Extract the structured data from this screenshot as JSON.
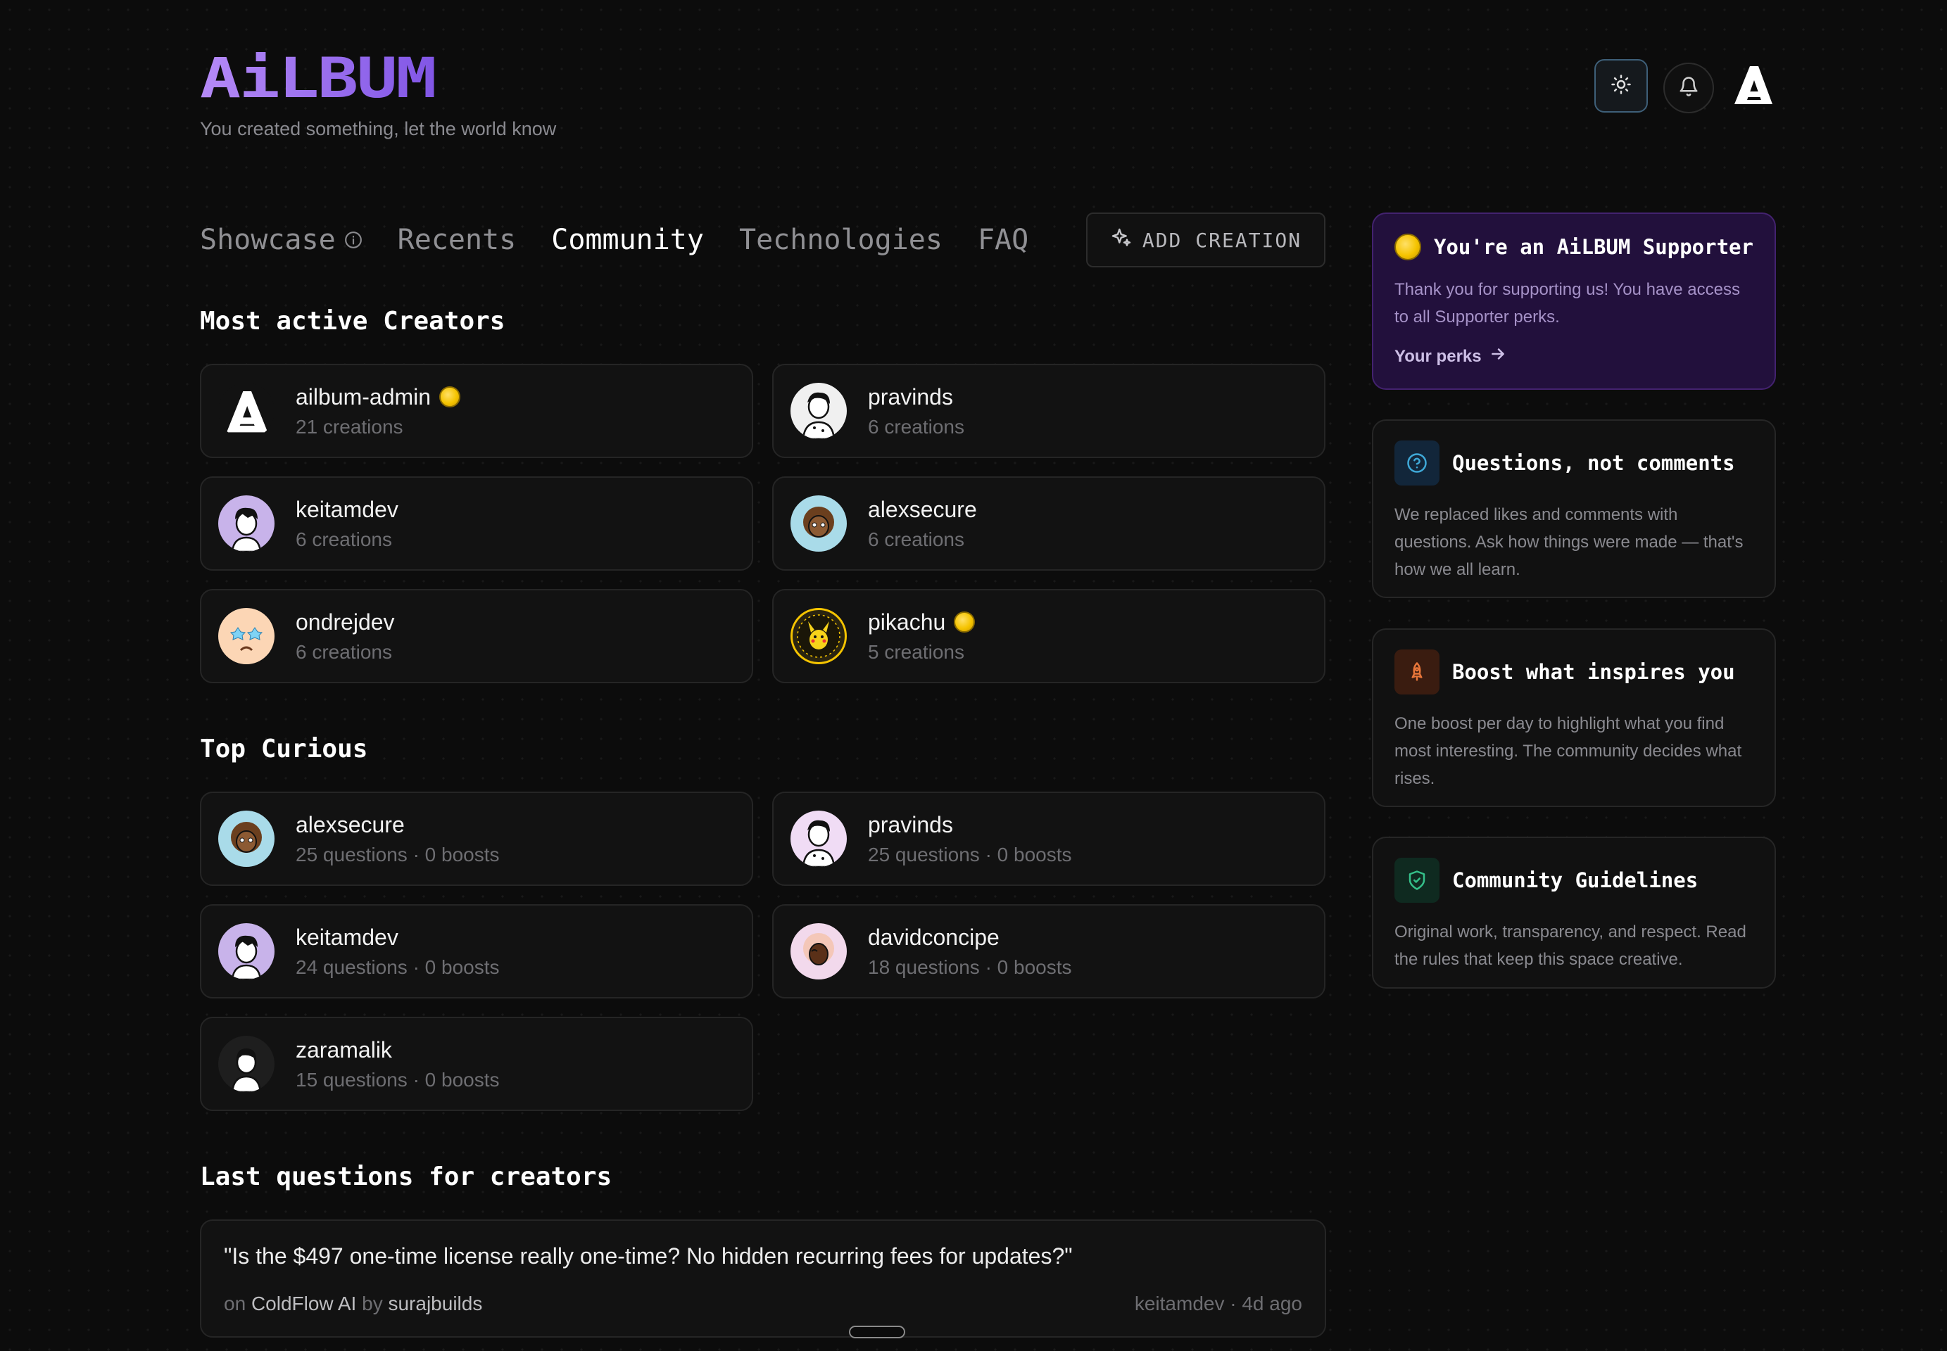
{
  "header": {
    "logo": "AiLBUM",
    "tagline": "You created something, let the world know",
    "theme_icon": "sun-icon",
    "notifications_icon": "bell-icon",
    "profile_icon": "profile-a-icon"
  },
  "nav": {
    "tabs": [
      {
        "label": "Showcase",
        "active": false,
        "has_info": true
      },
      {
        "label": "Recents",
        "active": false
      },
      {
        "label": "Community",
        "active": true
      },
      {
        "label": "Technologies",
        "active": false
      },
      {
        "label": "FAQ",
        "active": false
      }
    ],
    "add_creation_label": "ADD CREATION"
  },
  "most_active": {
    "title": "Most active Creators",
    "creators": [
      {
        "name": "ailbum-admin",
        "sub": "21 creations",
        "supporter": true
      },
      {
        "name": "pravinds",
        "sub": "6 creations",
        "supporter": false
      },
      {
        "name": "keitamdev",
        "sub": "6 creations",
        "supporter": false
      },
      {
        "name": "alexsecure",
        "sub": "6 creations",
        "supporter": false
      },
      {
        "name": "ondrejdev",
        "sub": "6 creations",
        "supporter": false
      },
      {
        "name": "pikachu",
        "sub": "5 creations",
        "supporter": true
      }
    ]
  },
  "top_curious": {
    "title": "Top Curious",
    "users": [
      {
        "name": "alexsecure",
        "sub": "25 questions · 0 boosts"
      },
      {
        "name": "pravinds",
        "sub": "25 questions · 0 boosts"
      },
      {
        "name": "keitamdev",
        "sub": "24 questions · 0 boosts"
      },
      {
        "name": "davidconcipe",
        "sub": "18 questions · 0 boosts"
      },
      {
        "name": "zaramalik",
        "sub": "15 questions · 0 boosts"
      }
    ]
  },
  "last_questions": {
    "title": "Last questions for creators",
    "items": [
      {
        "question": "\"Is the $497 one-time license really one-time? No hidden recurring fees for updates?\"",
        "on_label": "on",
        "project": "ColdFlow AI",
        "by_label": "by",
        "creator": "surajbuilds",
        "asker_meta": "keitamdev · 4d ago"
      }
    ]
  },
  "sidebar": {
    "supporter": {
      "title": "You're an AiLBUM Supporter",
      "body": "Thank you for supporting us! You have access to all Supporter perks.",
      "link": "Your perks"
    },
    "cards": [
      {
        "title": "Questions, not comments",
        "body": "We replaced likes and comments with questions. Ask how things were made — that's how we all learn.",
        "icon": "question-circle-icon",
        "color": "#3fa9d8"
      },
      {
        "title": "Boost what inspires you",
        "body": "One boost per day to highlight what you find most interesting. The community decides what rises.",
        "icon": "rocket-icon",
        "color": "#e8763a"
      },
      {
        "title": "Community Guidelines",
        "body": "Original work, transparency, and respect. Read the rules that keep this space creative.",
        "icon": "shield-check-icon",
        "color": "#35c08a"
      }
    ]
  },
  "colors": {
    "background": "#0c0c0c",
    "logo_gradient_start": "#a97cf5",
    "logo_gradient_end": "#7a4de0",
    "supporter_card": "#22103c",
    "coin": "#f5c400"
  }
}
